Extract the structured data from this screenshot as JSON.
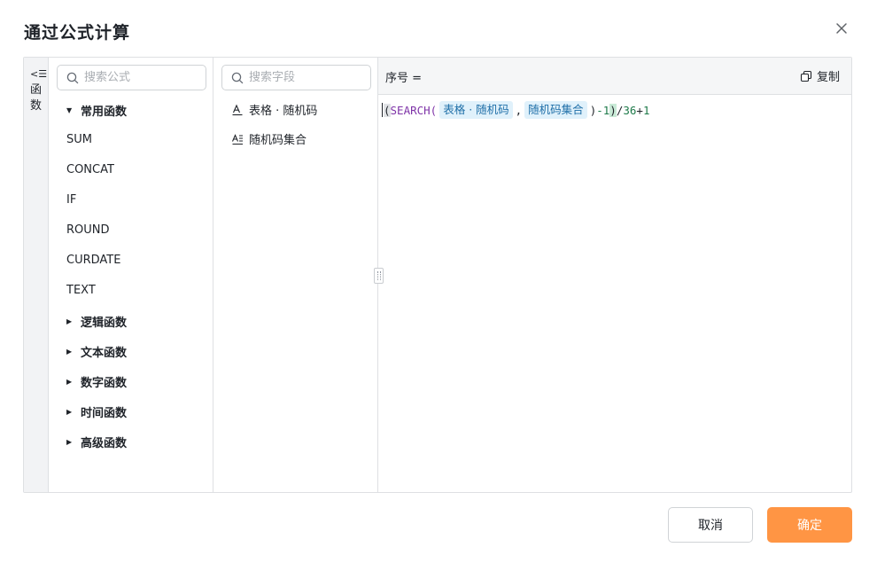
{
  "dialog": {
    "title": "通过公式计算"
  },
  "toggle": {
    "icon_glyph": "<☰",
    "label": "函数"
  },
  "functions": {
    "search_placeholder": "搜索公式",
    "common_group": "常用函数",
    "common_items": [
      "SUM",
      "CONCAT",
      "IF",
      "ROUND",
      "CURDATE",
      "TEXT"
    ],
    "groups": [
      "逻辑函数",
      "文本函数",
      "数字函数",
      "时间函数",
      "高级函数"
    ]
  },
  "fields": {
    "search_placeholder": "搜索字段",
    "items": [
      "表格 · 随机码",
      "随机码集合"
    ]
  },
  "editor": {
    "label": "序号 =",
    "copy_label": "复制",
    "formula": {
      "open": "(",
      "fn": "SEARCH(",
      "arg1": "表格 · 随机码",
      "comma": ",",
      "arg2": "随机码集合",
      "close_call": ")",
      "minus": "-1",
      "close_outer": ")",
      "tail_div": "/",
      "tail_num": "36",
      "tail_plus": "+",
      "tail_one": "1"
    }
  },
  "footer": {
    "cancel_label": "取消",
    "confirm_label": "确定"
  },
  "colors": {
    "accent": "#ff9544",
    "chip_bg": "#e0f1fb",
    "fn_color": "#7f34a8"
  }
}
